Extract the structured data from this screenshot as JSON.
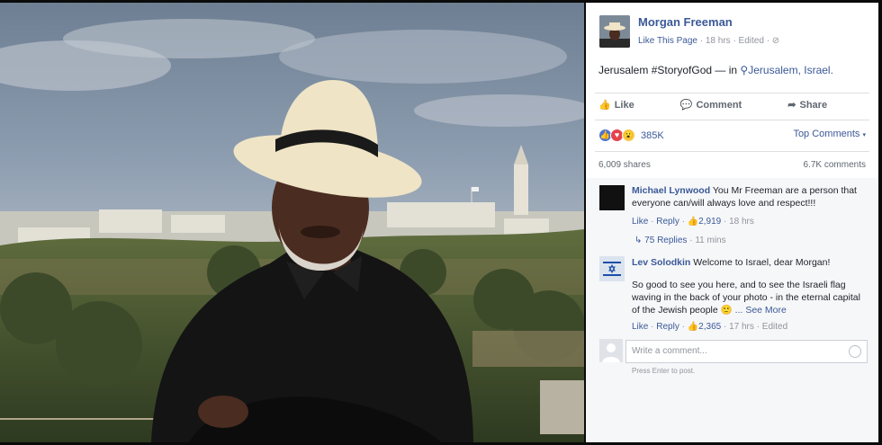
{
  "post": {
    "page_name": "Morgan Freeman",
    "like_page": "Like This Page",
    "time": "18 hrs",
    "edited": "Edited",
    "text_prefix": "Jerusalem #StoryofGod — in",
    "location": "Jerusalem, Israel."
  },
  "actions": {
    "like": "Like",
    "comment": "Comment",
    "share": "Share"
  },
  "reactions": {
    "count": "385K",
    "top_comments": "Top Comments"
  },
  "stats": {
    "shares": "6,009 shares",
    "comments": "6.7K comments"
  },
  "comments": [
    {
      "name": "Michael Lynwood",
      "text": "You Mr Freeman are a person that everyone can/will always love and respect!!!",
      "like": "Like",
      "reply": "Reply",
      "likes": "2,919",
      "time": "18 hrs",
      "replies": "75 Replies",
      "replies_time": "11 mins"
    },
    {
      "name": "Lev Solodkin",
      "text": "Welcome to Israel, dear Morgan!",
      "text2": "So good to see you here, and to see the Israeli flag waving in the back of your photo - in the eternal capital of the Jewish people",
      "see_more": "... See More",
      "like": "Like",
      "reply": "Reply",
      "likes": "2,365",
      "time": "17 hrs",
      "edited": "Edited"
    }
  ],
  "composer": {
    "placeholder": "Write a comment...",
    "hint": "Press Enter to post."
  },
  "colors": {
    "facebook_blue": "#3b5998",
    "panel_bg": "#ffffff",
    "comments_bg": "#f6f7f9"
  }
}
